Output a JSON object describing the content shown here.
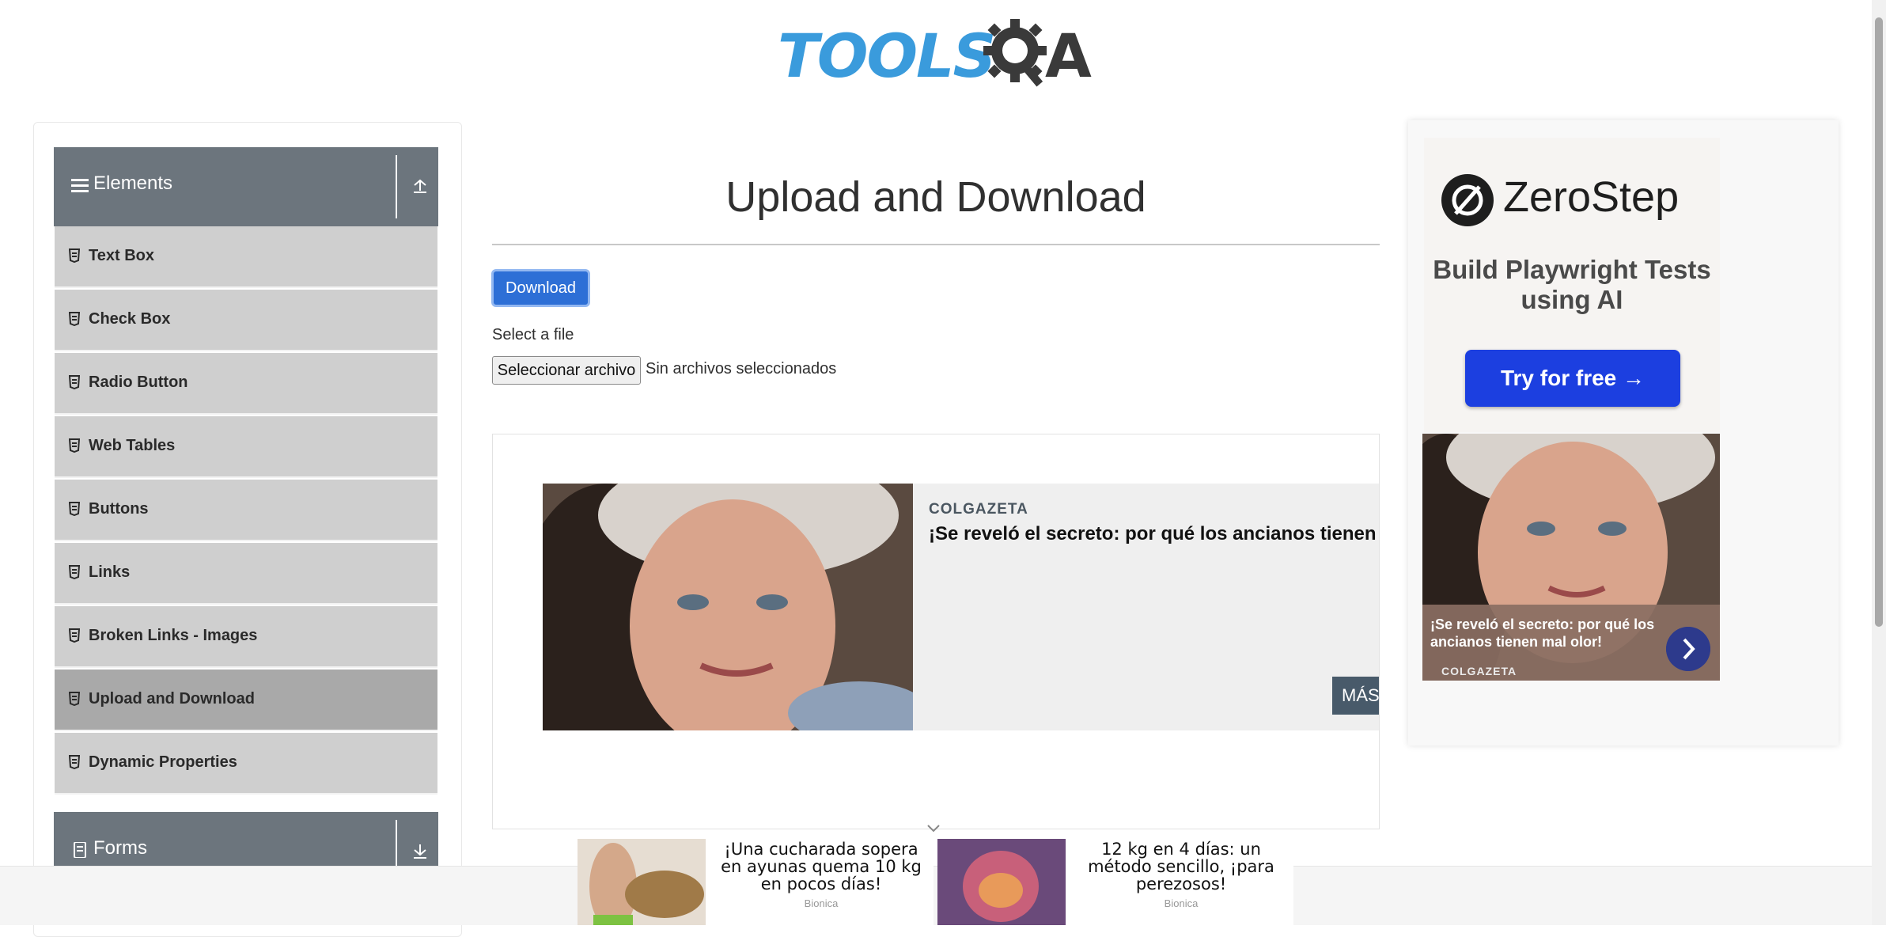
{
  "header": {
    "logo_text": "TOOLSQA"
  },
  "sidebar": {
    "groups": [
      {
        "label": "Elements"
      },
      {
        "label": "Forms"
      }
    ],
    "items": [
      {
        "label": "Text Box"
      },
      {
        "label": "Check Box"
      },
      {
        "label": "Radio Button"
      },
      {
        "label": "Web Tables"
      },
      {
        "label": "Buttons"
      },
      {
        "label": "Links"
      },
      {
        "label": "Broken Links - Images"
      },
      {
        "label": "Upload and Download",
        "active": true
      },
      {
        "label": "Dynamic Properties"
      }
    ]
  },
  "main": {
    "title": "Upload and Download",
    "download_label": "Download",
    "select_label": "Select a file",
    "file_button": "Seleccionar archivo",
    "file_status": "Sin archivos seleccionados"
  },
  "ad_main": {
    "source": "COLGAZETA",
    "headline": "¡Se reveló el secreto: por qué los ancianos tienen mal olor!",
    "cta": "MÁS INFORMACIÓN"
  },
  "ad_right": {
    "brand": "ZeroStep",
    "tagline": "Build Playwright Tests using AI",
    "cta": "Try for free →",
    "caption": "¡Se reveló el secreto: por qué los ancianos tienen mal olor!",
    "source": "COLGAZETA"
  },
  "bottom_ads": [
    {
      "text": "¡Una cucharada sopera en ayunas quema 10 kg en pocos días!",
      "source": "Bionica"
    },
    {
      "text": "12 kg en 4 días: un método sencillo, ¡para perezosos!",
      "source": "Bionica"
    }
  ],
  "colors": {
    "accent": "#2d6fd6",
    "sidebar_header": "#6c757d",
    "menu_item": "#cfcfcf",
    "menu_active": "#a9a9a9",
    "zerostep": "#1c3fe0"
  }
}
